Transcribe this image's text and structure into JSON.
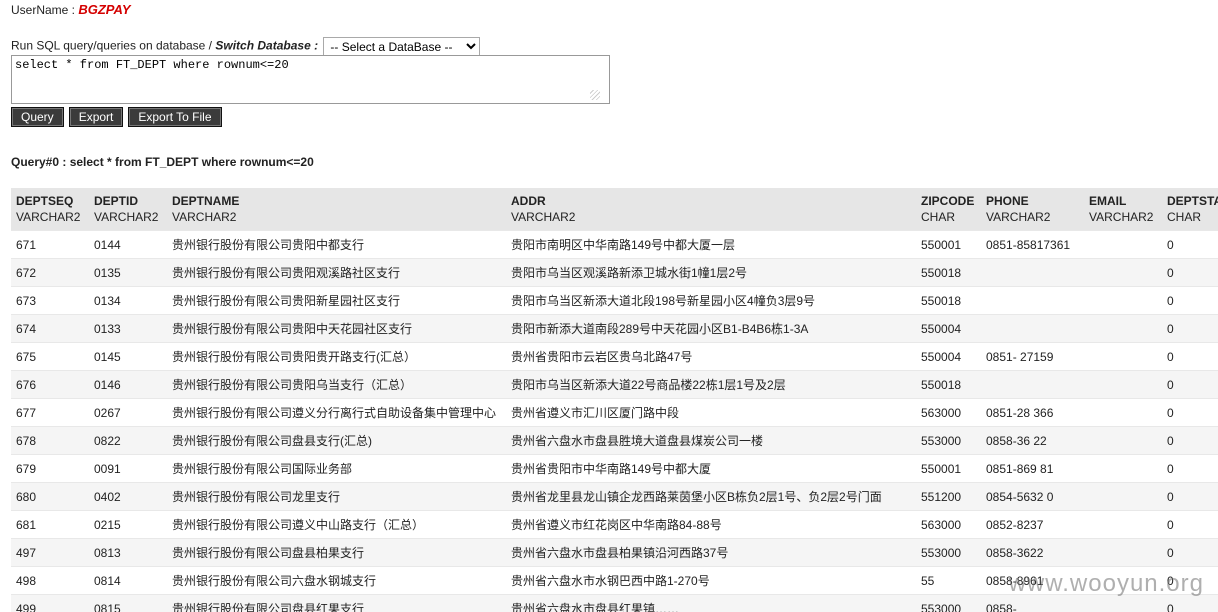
{
  "header": {
    "username_label": "UserName :",
    "username_value": "BGZPAY"
  },
  "query_bar": {
    "run_label": "Run SQL query/queries on database /",
    "switch_label": "Switch Database :",
    "select_value": "-- Select a DataBase --",
    "sql_text": "select * from FT_DEPT where rownum<=20"
  },
  "buttons": {
    "query": "Query",
    "export": "Export",
    "export_file": "Export To File"
  },
  "result": {
    "title": "Query#0 : select * from FT_DEPT where rownum<=20",
    "columns": [
      {
        "name": "DEPTSEQ",
        "type": "VARCHAR2"
      },
      {
        "name": "DEPTID",
        "type": "VARCHAR2"
      },
      {
        "name": "DEPTNAME",
        "type": "VARCHAR2"
      },
      {
        "name": "ADDR",
        "type": "VARCHAR2"
      },
      {
        "name": "ZIPCODE",
        "type": "CHAR"
      },
      {
        "name": "PHONE",
        "type": "VARCHAR2"
      },
      {
        "name": "EMAIL",
        "type": "VARCHAR2"
      },
      {
        "name": "DEPTSTA",
        "type": "CHAR"
      }
    ],
    "rows": [
      [
        "671",
        "0144",
        "贵州银行股份有限公司贵阳中都支行",
        "贵阳市南明区中华南路149号中都大厦一层",
        "550001",
        "0851-85817361",
        "",
        "0"
      ],
      [
        "672",
        "0135",
        "贵州银行股份有限公司贵阳观溪路社区支行",
        "贵阳市乌当区观溪路新添卫城水街1幢1层2号",
        "550018",
        "",
        "",
        "0"
      ],
      [
        "673",
        "0134",
        "贵州银行股份有限公司贵阳新星园社区支行",
        "贵阳市乌当区新添大道北段198号新星园小区4幢负3层9号",
        "550018",
        "",
        "",
        "0"
      ],
      [
        "674",
        "0133",
        "贵州银行股份有限公司贵阳中天花园社区支行",
        "贵阳市新添大道南段289号中天花园小区B1-B4B6栋1-3A",
        "550004",
        "",
        "",
        "0"
      ],
      [
        "675",
        "0145",
        "贵州银行股份有限公司贵阳贵开路支行(汇总）",
        "贵州省贵阳市云岩区贵乌北路47号",
        "550004",
        "0851-  27159",
        "",
        "0"
      ],
      [
        "676",
        "0146",
        "贵州银行股份有限公司贵阳乌当支行（汇总）",
        "贵阳市乌当区新添大道22号商品楼22栋1层1号及2层",
        "550018",
        "",
        "",
        "0"
      ],
      [
        "677",
        "0267",
        "贵州银行股份有限公司遵义分行离行式自助设备集中管理中心",
        "贵州省遵义市汇川区厦门路中段",
        "563000",
        "0851-28  366",
        "",
        "0"
      ],
      [
        "678",
        "0822",
        "贵州银行股份有限公司盘县支行(汇总)",
        "贵州省六盘水市盘县胜境大道盘县煤炭公司一楼",
        "553000",
        "0858-36  22",
        "",
        "0"
      ],
      [
        "679",
        "0091",
        "贵州银行股份有限公司国际业务部",
        "贵州省贵阳市中华南路149号中都大厦",
        "550001",
        "0851-869  81",
        "",
        "0"
      ],
      [
        "680",
        "0402",
        "贵州银行股份有限公司龙里支行",
        "贵州省龙里县龙山镇企龙西路莱茵堡小区B栋负2层1号、负2层2号门面",
        "551200",
        "0854-5632  0",
        "",
        "0"
      ],
      [
        "681",
        "0215",
        "贵州银行股份有限公司遵义中山路支行（汇总）",
        "贵州省遵义市红花岗区中华南路84-88号",
        "563000",
        "0852-8237",
        "",
        "0"
      ],
      [
        "497",
        "0813",
        "贵州银行股份有限公司盘县柏果支行",
        "贵州省六盘水市盘县柏果镇沿河西路37号",
        "553000",
        "0858-3622",
        "",
        "0"
      ],
      [
        "498",
        "0814",
        "贵州银行股份有限公司六盘水钢城支行",
        "贵州省六盘水市水钢巴西中路1-270号",
        "55",
        "0858-8961",
        "",
        "0"
      ],
      [
        "499",
        "0815",
        "贵州银行股份有限公司盘县红果支行",
        "贵州省六盘水市盘县红果镇……",
        "553000",
        "0858-",
        "",
        "0"
      ]
    ]
  },
  "watermark": "www.wooyun.org"
}
